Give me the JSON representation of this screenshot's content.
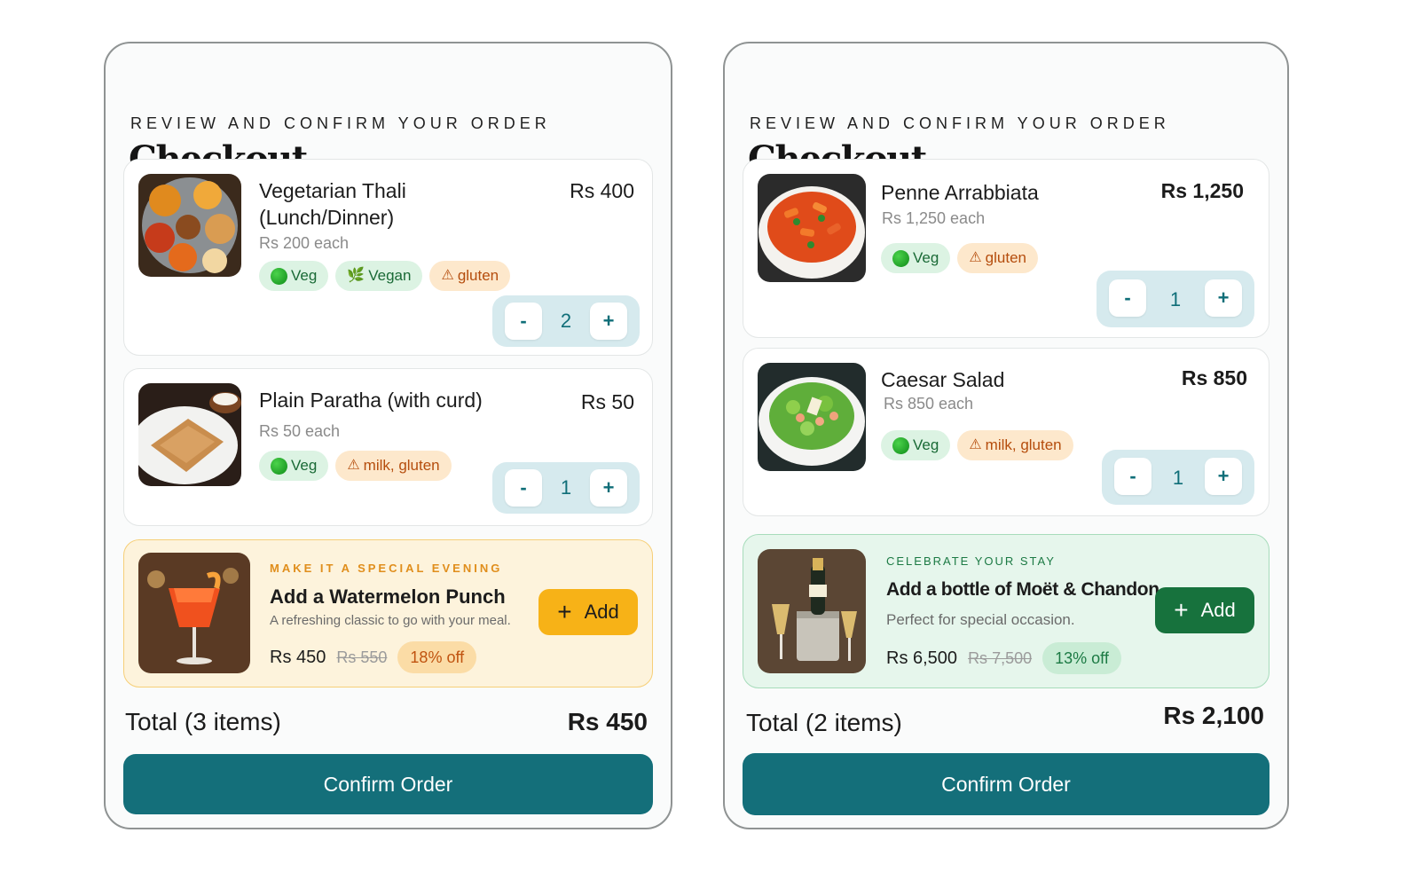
{
  "left": {
    "eyebrow": "REVIEW AND CONFIRM YOUR ORDER",
    "title": "Checkout",
    "items": [
      {
        "name": "Vegetarian Thali (Lunch/Dinner)",
        "price": "Rs 400",
        "each": "Rs 200 each",
        "tags": [
          "Veg",
          "Vegan",
          "gluten"
        ],
        "quantity": "2"
      },
      {
        "name": "Plain Paratha (with curd)",
        "price": "Rs 50",
        "each": "Rs 50 each",
        "tags": [
          "Veg",
          "milk, gluten"
        ],
        "quantity": "1"
      }
    ],
    "upsell": {
      "eyebrow": "MAKE IT A SPECIAL EVENING",
      "title": "Add a Watermelon Punch",
      "description": "A refreshing classic to go with your meal.",
      "price": "Rs 450",
      "old_price": "Rs 550",
      "discount": "18% off",
      "add_label": "Add"
    },
    "total_label": "Total (3 items)",
    "total_value": "Rs 450",
    "confirm_label": "Confirm Order"
  },
  "right": {
    "eyebrow": "REVIEW AND CONFIRM YOUR ORDER",
    "title": "Checkout",
    "items": [
      {
        "name": "Penne Arrabbiata",
        "price": "Rs 1,250",
        "each": "Rs 1,250 each",
        "tags": [
          "Veg",
          "gluten"
        ],
        "quantity": "1"
      },
      {
        "name": "Caesar Salad",
        "price": "Rs 850",
        "each": "Rs 850 each",
        "tags": [
          "Veg",
          "milk, gluten"
        ],
        "quantity": "1"
      }
    ],
    "upsell": {
      "eyebrow": "CELEBRATE YOUR STAY",
      "title": "Add a bottle of Moët & Chandon",
      "description": "Perfect for special occasion.",
      "price": "Rs 6,500",
      "old_price": "Rs 7,500",
      "discount": "13% off",
      "add_label": "Add"
    },
    "total_label": "Total (2 items)",
    "total_value": "Rs 2,100",
    "confirm_label": "Confirm Order"
  },
  "qty_labels": {
    "minus": "-",
    "plus": "+"
  },
  "icons": {
    "veg": "green-dot-icon",
    "vegan": "leaf-icon",
    "allergen": "warning-icon",
    "add": "plus-icon"
  },
  "colors": {
    "primary": "#146f7a",
    "veg_tag_bg": "#dcf3e3",
    "allergen_tag_bg": "#fde8cc",
    "qty_bg": "#d6eaee",
    "upsell_yellow": "#fdf3dc",
    "upsell_mint": "#e6f6ec",
    "add_orange": "#f7b217",
    "add_green": "#17723d"
  }
}
